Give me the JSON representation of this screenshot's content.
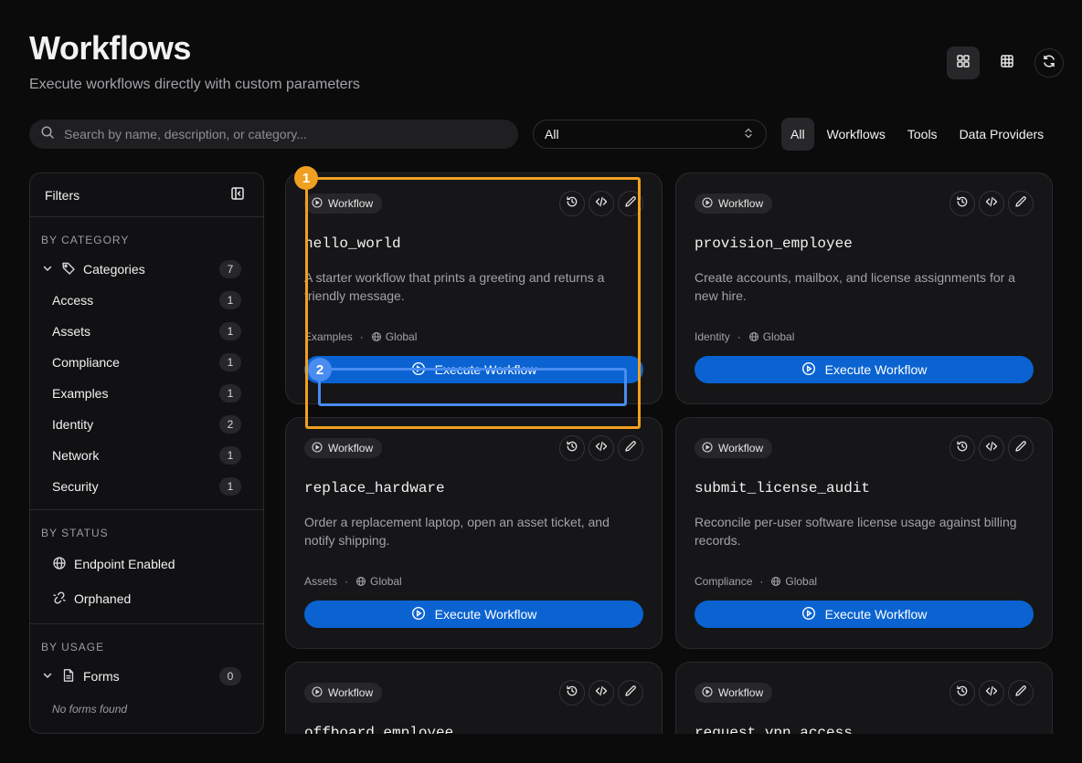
{
  "header": {
    "title": "Workflows",
    "subtitle": "Execute workflows directly with custom parameters"
  },
  "toolbar": {
    "view_icons": [
      "grid-icon",
      "table-icon",
      "refresh-icon"
    ]
  },
  "search": {
    "placeholder": "Search by name, description, or category...",
    "value": ""
  },
  "scope_select": {
    "value": "All"
  },
  "type_tabs": [
    {
      "label": "All",
      "active": true
    },
    {
      "label": "Workflows",
      "active": false
    },
    {
      "label": "Tools",
      "active": false
    },
    {
      "label": "Data Providers",
      "active": false
    }
  ],
  "filters": {
    "title": "Filters",
    "by_category_label": "BY CATEGORY",
    "categories_label": "Categories",
    "categories_count": "7",
    "categories": [
      {
        "label": "Access",
        "count": "1"
      },
      {
        "label": "Assets",
        "count": "1"
      },
      {
        "label": "Compliance",
        "count": "1"
      },
      {
        "label": "Examples",
        "count": "1"
      },
      {
        "label": "Identity",
        "count": "2"
      },
      {
        "label": "Network",
        "count": "1"
      },
      {
        "label": "Security",
        "count": "1"
      }
    ],
    "by_status_label": "BY STATUS",
    "status_items": [
      {
        "label": "Endpoint Enabled",
        "icon": "globe-icon"
      },
      {
        "label": "Orphaned",
        "icon": "broken-link-icon"
      }
    ],
    "by_usage_label": "BY USAGE",
    "forms_label": "Forms",
    "forms_count": "0",
    "no_forms": "No forms found"
  },
  "cards": [
    {
      "pill": "Workflow",
      "name": "hello_world",
      "desc": "A starter workflow that prints a greeting and returns a friendly message.",
      "category": "Examples",
      "scope": "Global",
      "button": "Execute Workflow"
    },
    {
      "pill": "Workflow",
      "name": "provision_employee",
      "desc": "Create accounts, mailbox, and license assignments for a new hire.",
      "category": "Identity",
      "scope": "Global",
      "button": "Execute Workflow"
    },
    {
      "pill": "Workflow",
      "name": "replace_hardware",
      "desc": "Order a replacement laptop, open an asset ticket, and notify shipping.",
      "category": "Assets",
      "scope": "Global",
      "button": "Execute Workflow"
    },
    {
      "pill": "Workflow",
      "name": "submit_license_audit",
      "desc": "Reconcile per-user software license usage against billing records.",
      "category": "Compliance",
      "scope": "Global",
      "button": "Execute Workflow"
    },
    {
      "pill": "Workflow",
      "name": "offboard_employee",
      "desc": "",
      "category": "",
      "scope": "",
      "button": ""
    },
    {
      "pill": "Workflow",
      "name": "request_vpn_access",
      "desc": "",
      "category": "",
      "scope": "",
      "button": ""
    }
  ],
  "annotations": {
    "marker_1": "1",
    "marker_2": "2"
  },
  "colors": {
    "background": "#0b0b0c",
    "card": "#161618",
    "accent_button": "#0a63d1",
    "highlight_orange": "#f0a020",
    "highlight_blue": "#4a8cf0"
  }
}
